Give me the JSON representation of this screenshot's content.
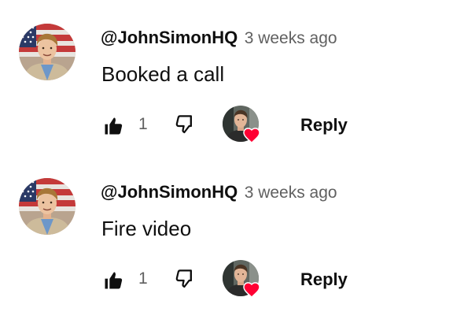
{
  "comments": [
    {
      "author": "@JohnSimonHQ",
      "time": "3 weeks ago",
      "text": "Booked a call",
      "like_count": "1",
      "reply_label": "Reply",
      "hearted_by_creator": true,
      "liked": true
    },
    {
      "author": "@JohnSimonHQ",
      "time": "3 weeks ago",
      "text": "Fire video",
      "like_count": "1",
      "reply_label": "Reply",
      "hearted_by_creator": true,
      "liked": true
    }
  ],
  "colors": {
    "text_primary": "#0f0f0f",
    "text_secondary": "#606060",
    "heart": "#ff0033"
  },
  "icons": {
    "like": "thumb-up-filled-icon",
    "dislike": "thumb-down-outline-icon",
    "heart": "heart-icon"
  }
}
